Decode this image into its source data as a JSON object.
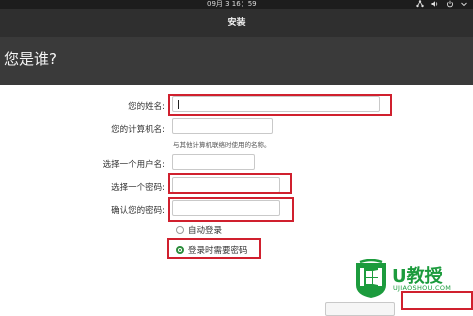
{
  "system_bar": {
    "clock": "09月 3 16：59"
  },
  "window": {
    "title": "安装"
  },
  "page": {
    "heading": "您是谁?"
  },
  "form": {
    "name_label": "您的姓名:",
    "name_value": "",
    "computer_label": "您的计算机名:",
    "computer_value": "",
    "computer_hint": "与其他计算机联络时使用的名称。",
    "username_label": "选择一个用户名:",
    "username_value": "",
    "password_label": "选择一个密码:",
    "password_value": "",
    "confirm_label": "确认您的密码:",
    "confirm_value": "",
    "auto_login_label": "自动登录",
    "require_password_label": "登录时需要密码",
    "selected_login_option": "require_password"
  },
  "watermark": {
    "brand": "U教授",
    "domain": "UJIAOSHOU.COM"
  },
  "colors": {
    "highlight": "#d0202e",
    "radio_checked": "#2a8c3a",
    "watermark": "#1c9b3d"
  }
}
